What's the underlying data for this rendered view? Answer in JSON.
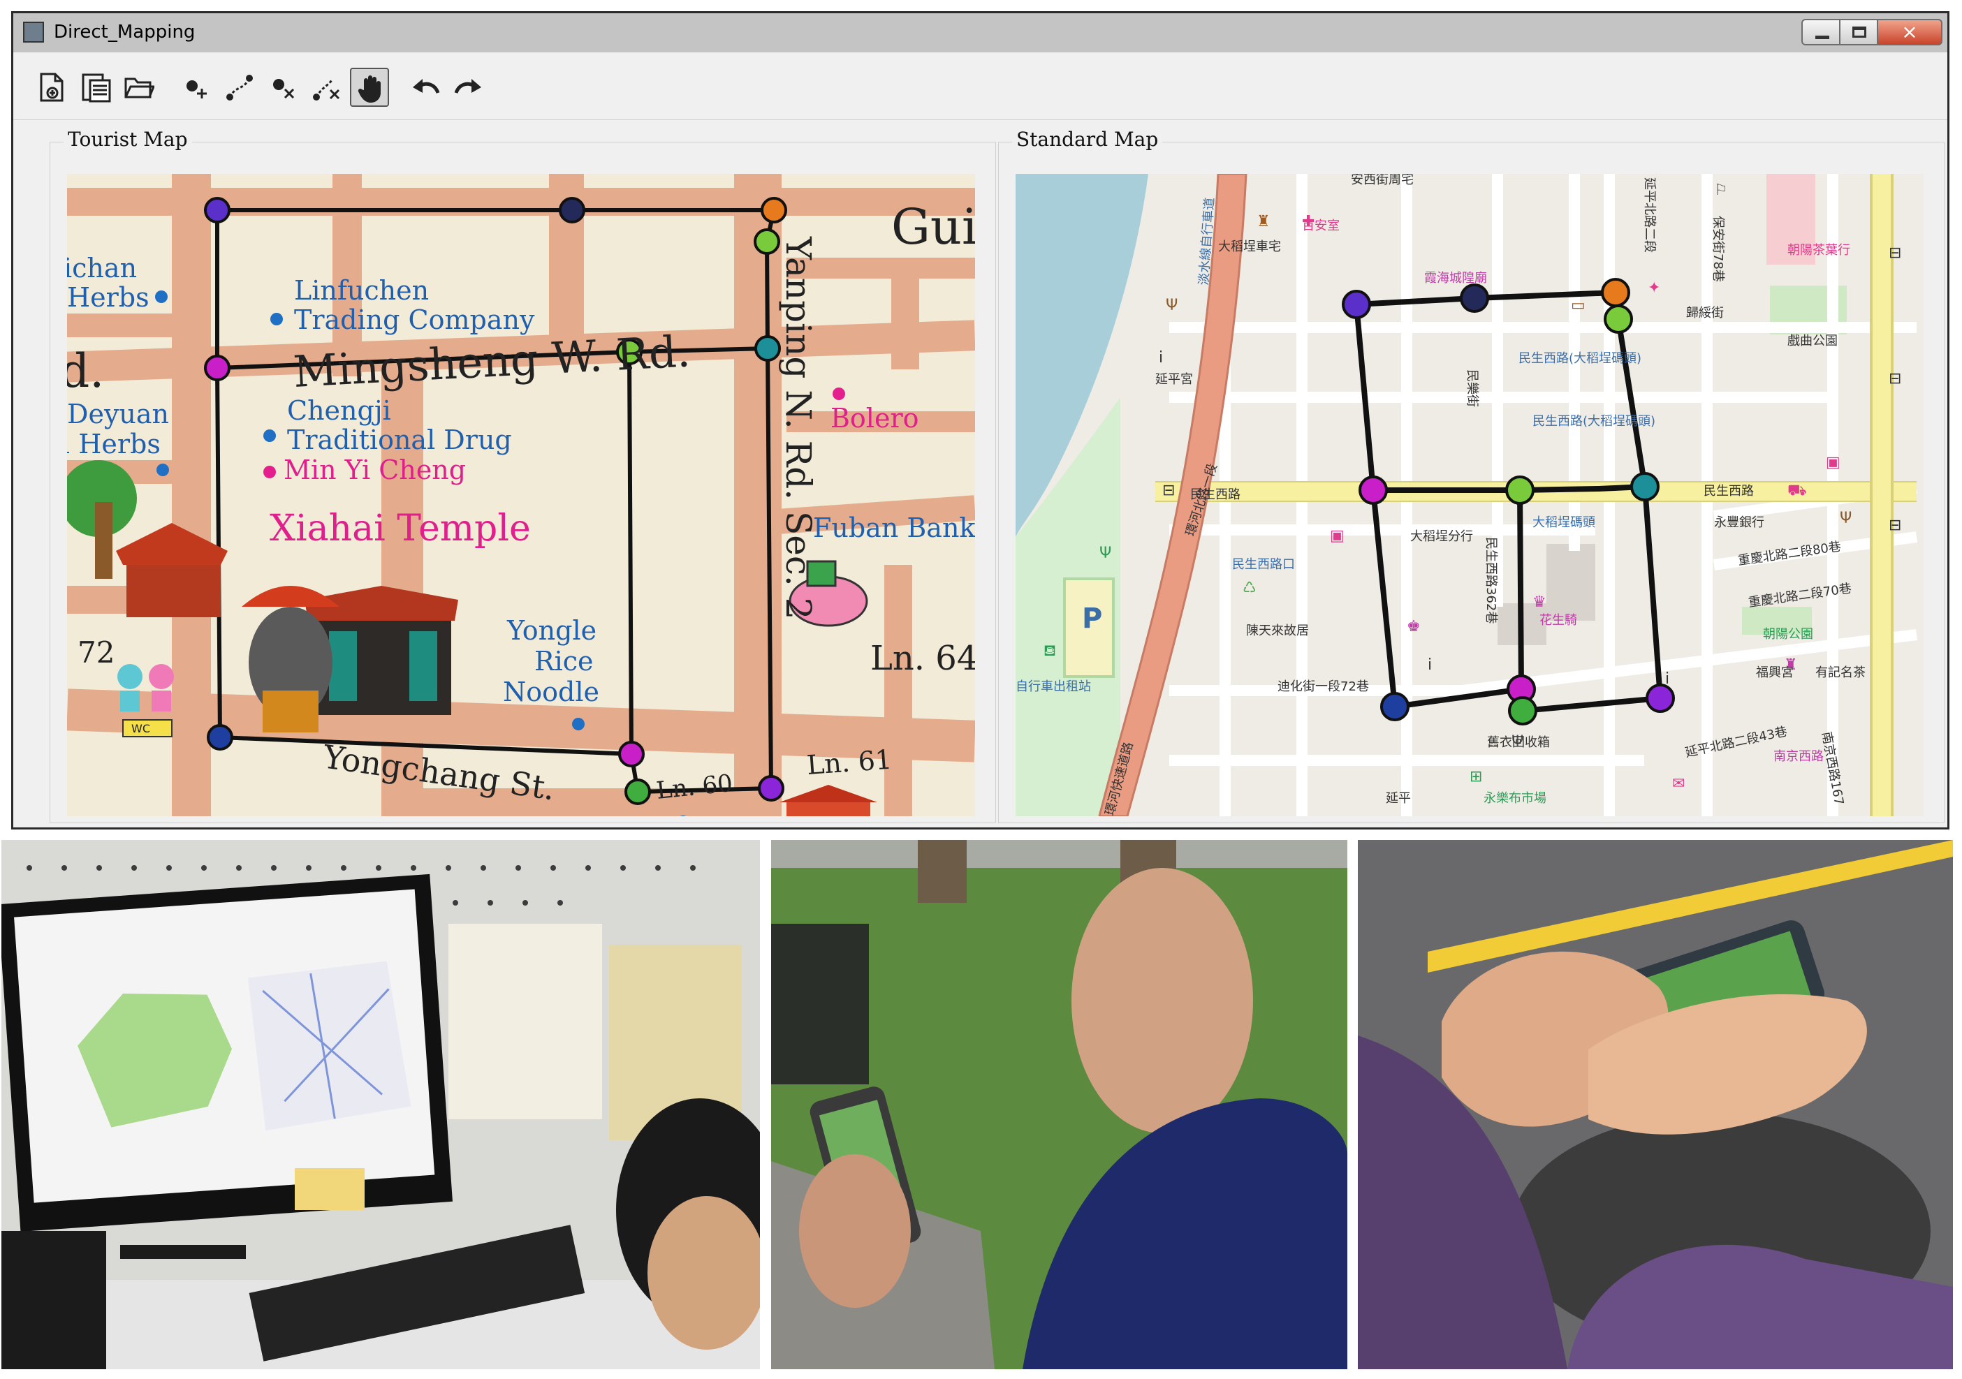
{
  "window": {
    "title": "Direct_Mapping",
    "controls": {
      "minimize": "minimize-icon",
      "maximize": "maximize-icon",
      "close": "×"
    }
  },
  "toolbar": {
    "tools": [
      {
        "name": "new-file-icon"
      },
      {
        "name": "save-file-icon"
      },
      {
        "name": "open-folder-icon"
      },
      {
        "name": "add-node-icon"
      },
      {
        "name": "add-edge-icon"
      },
      {
        "name": "delete-node-icon"
      },
      {
        "name": "delete-edge-icon"
      },
      {
        "name": "pan-hand-icon",
        "active": true
      },
      {
        "name": "undo-icon"
      },
      {
        "name": "redo-icon"
      }
    ]
  },
  "tourist_map": {
    "title": "Tourist Map",
    "labels": {
      "gui": "Gui",
      "chan": "ichan",
      "herbs1": "Herbs",
      "rd": "d.",
      "deyuan": "Deyuan",
      "herbs2": "l Herbs",
      "linfuchen": "Linfuchen",
      "trading": "Trading Company",
      "mingsheng": "Mingsheng W. Rd.",
      "chengji": "Chengji",
      "traditional": "Traditional Drug",
      "minyi": "Min Yi Cheng",
      "xiahai": "Xiahai Temple",
      "bolero": "Bolero",
      "fuban": "Fuban Bank",
      "yanping": "Yanping N. Rd. Sec. 2",
      "yongle": "Yongle",
      "rice": "Rice",
      "noodle": "Noodle",
      "yongchang": "Yongchang St.",
      "ln60": "Ln. 60",
      "ln61": "Ln. 61",
      "ln64": "Ln. 64",
      "n72": "72",
      "wc": "WC"
    }
  },
  "standard_map": {
    "title": "Standard Map",
    "labels": {
      "anxi": "安西街周宅",
      "yanping_n2a": "延平北路二段",
      "baoan": "保安街78巷",
      "dadaocheng": "大稻埕車宅",
      "baianshi": "百安室",
      "guihuajie": "歸綏街",
      "xizhen": "霞海城隍廟",
      "minsheng_w": "民生西路",
      "minsheng_w2": "民生西路口",
      "minsheng_w3": "民生西路(大稻埕碼頭)",
      "minsheng_w4": "民生西路(大稻埕碼頭)",
      "park": "戲曲公園",
      "dadaocheng_branch": "大稻埕分行",
      "tianmaster": "陳天來故居",
      "yanping_office": "延平宮",
      "minle": "民樂街",
      "dihua": "迪化街一段72巷",
      "chongqing80": "重慶北路二段80巷",
      "chongqing70": "重慶北路二段70巷",
      "chaoyang": "朝陽公園",
      "yongle_market": "永樂布市場",
      "yanping_n2b": "延平北路二段43巷",
      "nanjing": "南京西路",
      "huanhe": "環河北路一段",
      "cloth": "舊衣回收箱",
      "fumao": "福興宮",
      "yongfeng": "永豐銀行",
      "flower": "花生騎",
      "yellow_hall": "大稻埕碼頭",
      "minsheng_road_label": "民生西路",
      "huanhe2": "環河快速道路",
      "minsheng_w5": "民生西路362巷",
      "wholesale": "有記名茶",
      "nanjing_lane": "南京西路167",
      "chenyi": "朝陽茶葉行",
      "bike": "自行車出租站",
      "ping": "P",
      "dock_road": "淡水線自行車道",
      "yanping_label": "延平"
    }
  },
  "photos": {
    "desk": "photo-desk-user-at-computer",
    "park": "photo-park-user-with-phone",
    "hands": "photo-user-hands-on-phone"
  },
  "colors": {
    "node_purple": "#5b2fc9",
    "node_navy": "#232a5a",
    "node_orange": "#e87a1e",
    "node_green": "#7acb3c",
    "node_teal": "#1d8f98",
    "node_magenta": "#c81fc8",
    "node_violet": "#8a25d9",
    "node_blue": "#1f3fa0",
    "road_tourist": "#e0a584",
    "paper": "#f2ebd8",
    "map_bg": "#efece6",
    "major_road": "#ea9c83",
    "yellow_road": "#f6f0a0",
    "water": "#a8cfd9",
    "park_green": "#cfe9c5"
  }
}
